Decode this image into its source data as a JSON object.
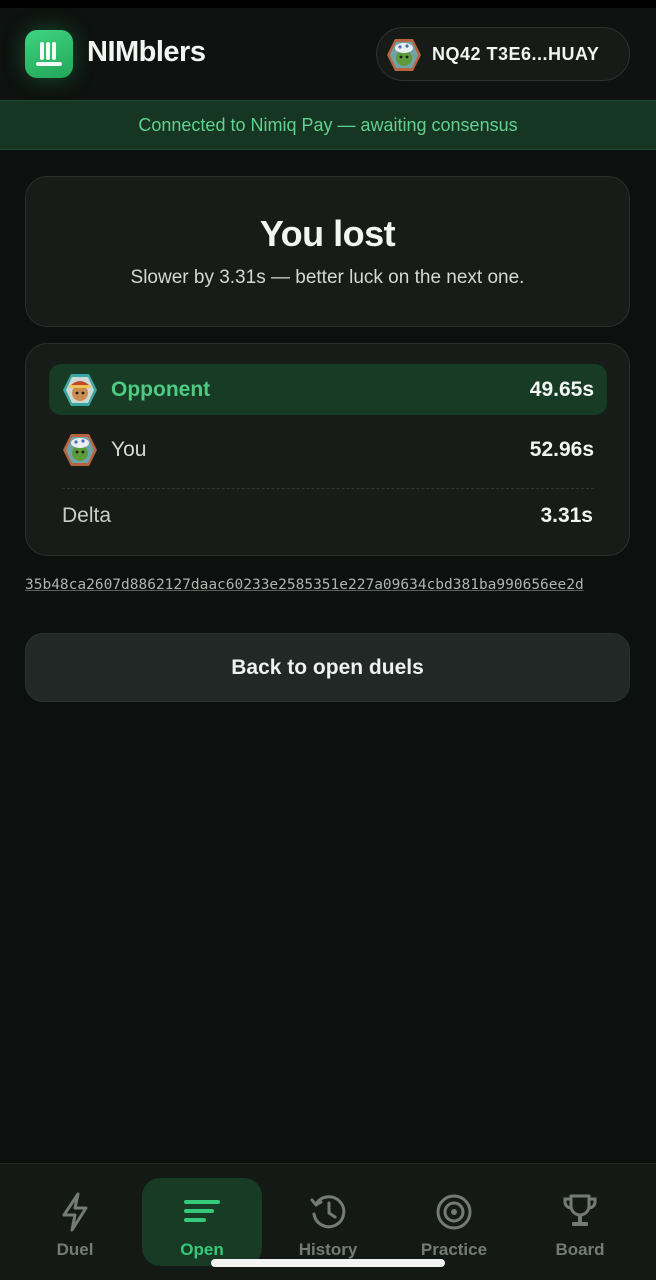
{
  "app": {
    "name": "NIMblers"
  },
  "wallet": {
    "address": "NQ42 T3E6...HUAY"
  },
  "status_banner": {
    "text": "Connected to Nimiq Pay — awaiting consensus"
  },
  "result": {
    "title": "You lost",
    "subtitle": "Slower by 3.31s — better luck on the next one."
  },
  "times": {
    "opponent": {
      "label": "Opponent",
      "time": "49.65s"
    },
    "you": {
      "label": "You",
      "time": "52.96s"
    },
    "delta": {
      "label": "Delta",
      "value": "3.31s"
    }
  },
  "tx_hash": "35b48ca2607d8862127daac60233e2585351e227a09634cbd381ba990656ee2d",
  "back_button": {
    "label": "Back to open duels"
  },
  "nav": {
    "items": [
      {
        "label": "Duel",
        "icon": "lightning-icon",
        "active": false
      },
      {
        "label": "Open",
        "icon": "list-icon",
        "active": true
      },
      {
        "label": "History",
        "icon": "history-icon",
        "active": false
      },
      {
        "label": "Practice",
        "icon": "target-icon",
        "active": false
      },
      {
        "label": "Board",
        "icon": "trophy-icon",
        "active": false
      }
    ]
  },
  "colors": {
    "accent": "#37c97a",
    "background": "#0c100e",
    "card": "#171c19",
    "banner": "#163522",
    "active_row": "#173b25"
  }
}
